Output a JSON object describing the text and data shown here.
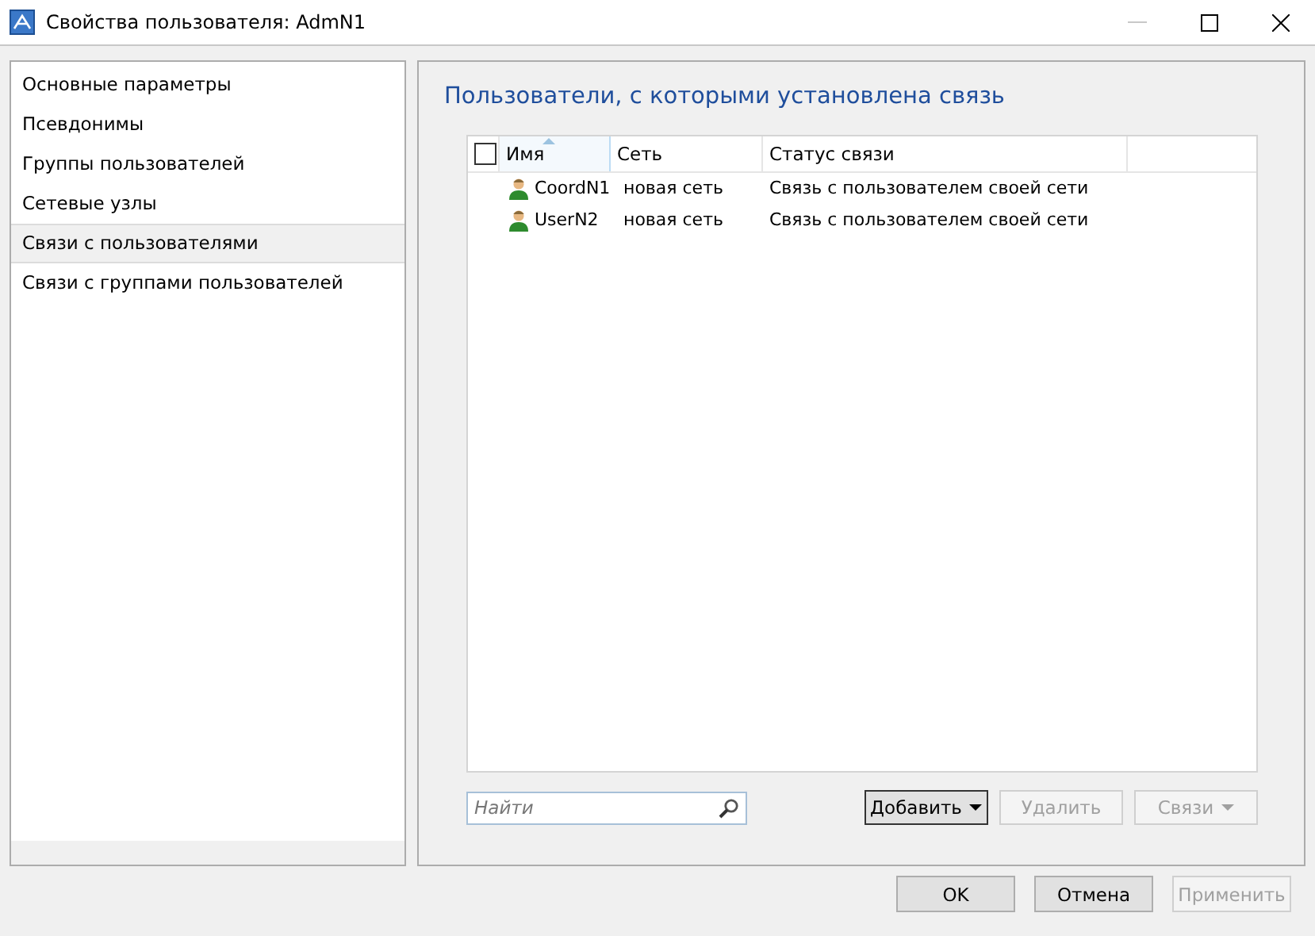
{
  "window": {
    "title": "Свойства пользователя: AdmN1",
    "minimize_disabled": true
  },
  "sidebar": {
    "items": [
      {
        "label": "Основные параметры",
        "selected": false
      },
      {
        "label": "Псевдонимы",
        "selected": false
      },
      {
        "label": "Группы пользователей",
        "selected": false
      },
      {
        "label": "Сетевые узлы",
        "selected": false
      },
      {
        "label": "Связи с пользователями",
        "selected": true
      },
      {
        "label": "Связи с группами пользователей",
        "selected": false
      }
    ]
  },
  "panel": {
    "heading": "Пользователи, с которыми установлена связь",
    "table": {
      "select_all_checked": false,
      "columns": [
        "Имя",
        "Сеть",
        "Статус связи"
      ],
      "rows": [
        {
          "name": "CoordN1",
          "network": "новая сеть",
          "status": "Связь с пользователем своей сети"
        },
        {
          "name": "UserN2",
          "network": "новая сеть",
          "status": "Связь с пользователем своей сети"
        }
      ]
    },
    "search": {
      "placeholder": "Найти"
    },
    "buttons": [
      {
        "label": "Добавить",
        "disabled": false,
        "dropdown": true
      },
      {
        "label": "Удалить",
        "disabled": true,
        "dropdown": false
      },
      {
        "label": "Связи",
        "disabled": true,
        "dropdown": true
      }
    ]
  },
  "footer_buttons": [
    {
      "label": "OK",
      "disabled": false
    },
    {
      "label": "Отмена",
      "disabled": false
    },
    {
      "label": "Применить",
      "disabled": true
    }
  ]
}
